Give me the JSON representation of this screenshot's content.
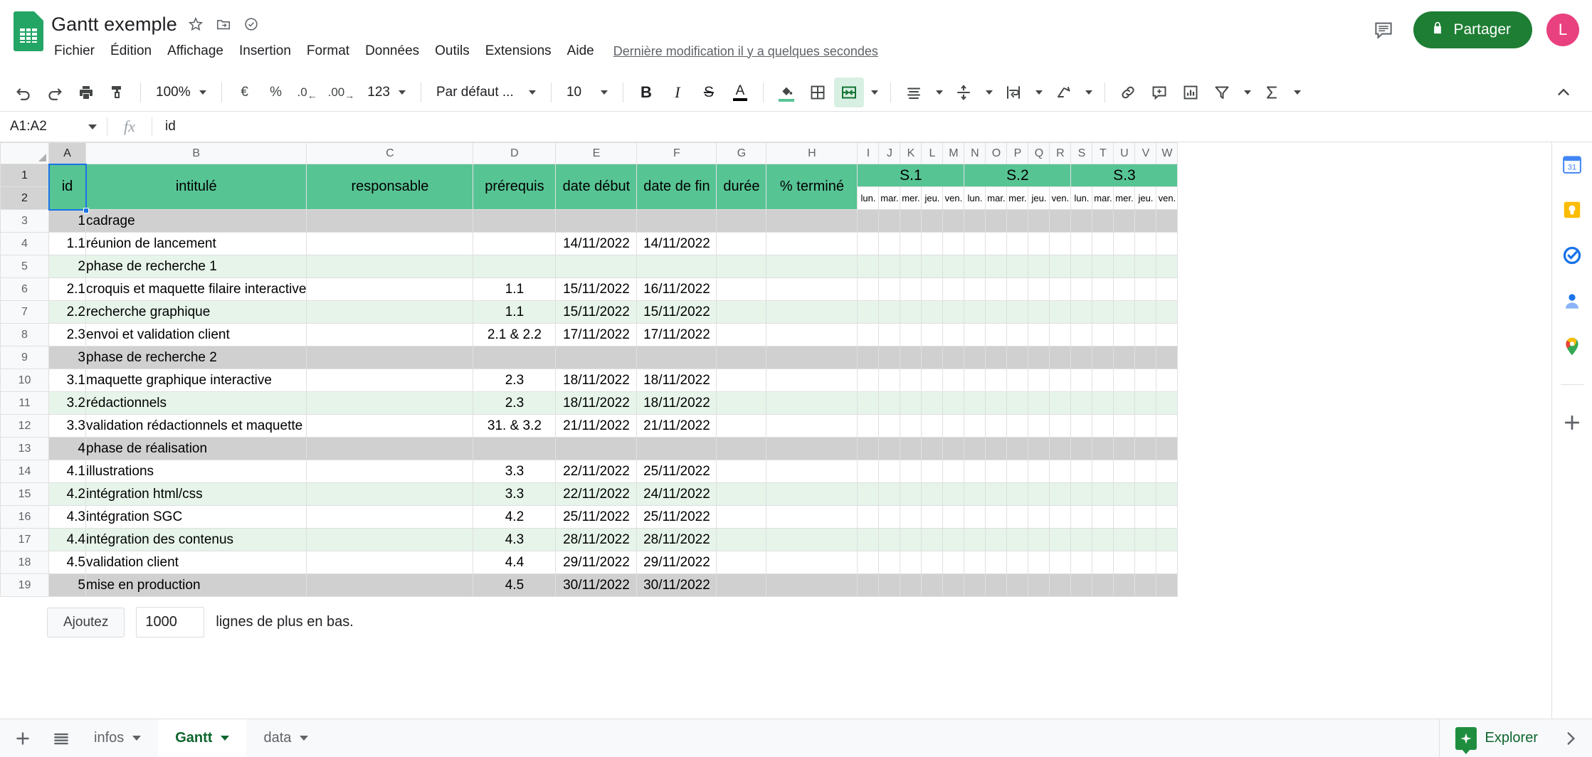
{
  "app": {
    "doc_title": "Gantt exemple",
    "logo_icon": "sheets-icon",
    "star_icon": "star-icon",
    "move_icon": "move-to-folder-icon",
    "cloud_icon": "cloud-saved-icon"
  },
  "menu": {
    "items": [
      {
        "label": "Fichier",
        "name": "menu-fichier"
      },
      {
        "label": "Édition",
        "name": "menu-edition"
      },
      {
        "label": "Affichage",
        "name": "menu-affichage"
      },
      {
        "label": "Insertion",
        "name": "menu-insertion"
      },
      {
        "label": "Format",
        "name": "menu-format"
      },
      {
        "label": "Données",
        "name": "menu-donnees"
      },
      {
        "label": "Outils",
        "name": "menu-outils"
      },
      {
        "label": "Extensions",
        "name": "menu-extensions"
      },
      {
        "label": "Aide",
        "name": "menu-aide"
      }
    ],
    "last_edit": "Dernière modification il y a quelques secondes"
  },
  "header_right": {
    "comment_icon": "comment-history-icon",
    "share_label": "Partager",
    "share_icon": "lock-icon",
    "share_color": "#1e7e34",
    "avatar_letter": "L",
    "avatar_color": "#e9417f"
  },
  "toolbar": {
    "undo": "undo-icon",
    "redo": "redo-icon",
    "print": "print-icon",
    "paint": "paint-format-icon",
    "zoom_value": "100%",
    "currency": "€",
    "percent": "%",
    "decimal_decrease": ".0",
    "decimal_increase": ".00",
    "number_format": "123",
    "font_name": "Par défaut ...",
    "font_size": "10",
    "bold": "B",
    "italic": "I",
    "strikethrough": "S",
    "text_color": "A",
    "fill_color": "fill-color-icon",
    "borders": "borders-icon",
    "merge_cells": "merge-cells-icon",
    "horizontal_align": "horizontal-align-icon",
    "vertical_align": "vertical-align-icon",
    "text_wrap": "text-wrap-icon",
    "text_rotation": "text-rotation-icon",
    "insert_link": "link-icon",
    "insert_comment": "insert-comment-icon",
    "insert_chart": "insert-chart-icon",
    "filter": "filter-icon",
    "functions": "sum-functions-icon",
    "collapse": "collapse-toolbar-icon"
  },
  "formula_bar": {
    "name_box": "A1:A2",
    "fx_label": "fx",
    "value": "id"
  },
  "grid": {
    "column_letters": [
      "A",
      "B",
      "C",
      "D",
      "E",
      "F",
      "G",
      "H",
      "I",
      "J",
      "K",
      "L",
      "M",
      "N",
      "O",
      "P",
      "Q",
      "R",
      "S",
      "T",
      "U",
      "V",
      "W"
    ],
    "selected_columns": [
      "A"
    ],
    "row_numbers": [
      1,
      2,
      3,
      4,
      5,
      6,
      7,
      8,
      9,
      10,
      11,
      12,
      13,
      14,
      15,
      16,
      17,
      18,
      19
    ],
    "selected_rows": [
      1,
      2
    ],
    "headers": {
      "id": "id",
      "intitule": "intitulé",
      "responsable": "responsable",
      "prerequis": "prérequis",
      "date_debut": "date début",
      "date_fin": "date de fin",
      "duree": "durée",
      "pct_termine": "% terminé"
    },
    "weeks": [
      {
        "label": "S.1",
        "days": [
          "lun.",
          "mar.",
          "mer.",
          "jeu.",
          "ven."
        ]
      },
      {
        "label": "S.2",
        "days": [
          "lun.",
          "mar.",
          "mer.",
          "jeu.",
          "ven."
        ]
      },
      {
        "label": "S.3",
        "days": [
          "lun.",
          "mar.",
          "mer.",
          "jeu.",
          "ven."
        ]
      }
    ],
    "header_color": "#57c494",
    "phase_row_color": "#d0d0d0",
    "alt_row_color": "#e6f4ea",
    "rows": [
      {
        "row": 3,
        "style": "r-gray",
        "id": "1",
        "intitule": "cadrage",
        "responsable": "",
        "prerequis": "",
        "date_debut": "",
        "date_fin": "",
        "duree": "",
        "pct": ""
      },
      {
        "row": 4,
        "style": "r-white",
        "id": "1.1",
        "intitule": "réunion de lancement",
        "responsable": "",
        "prerequis": "",
        "date_debut": "14/11/2022",
        "date_fin": "14/11/2022",
        "duree": "",
        "pct": ""
      },
      {
        "row": 5,
        "style": "r-green",
        "id": "2",
        "intitule": "phase de recherche 1",
        "responsable": "",
        "prerequis": "",
        "date_debut": "",
        "date_fin": "",
        "duree": "",
        "pct": ""
      },
      {
        "row": 6,
        "style": "r-white",
        "id": "2.1",
        "intitule": "croquis et maquette filaire interactive",
        "responsable": "",
        "prerequis": "1.1",
        "date_debut": "15/11/2022",
        "date_fin": "16/11/2022",
        "duree": "",
        "pct": ""
      },
      {
        "row": 7,
        "style": "r-green",
        "id": "2.2",
        "intitule": "recherche graphique",
        "responsable": "",
        "prerequis": "1.1",
        "date_debut": "15/11/2022",
        "date_fin": "15/11/2022",
        "duree": "",
        "pct": ""
      },
      {
        "row": 8,
        "style": "r-white",
        "id": "2.3",
        "intitule": "envoi et validation client",
        "responsable": "",
        "prerequis": "2.1 & 2.2",
        "date_debut": "17/11/2022",
        "date_fin": "17/11/2022",
        "duree": "",
        "pct": ""
      },
      {
        "row": 9,
        "style": "r-gray",
        "id": "3",
        "intitule": "phase de recherche 2",
        "responsable": "",
        "prerequis": "",
        "date_debut": "",
        "date_fin": "",
        "duree": "",
        "pct": ""
      },
      {
        "row": 10,
        "style": "r-white",
        "id": "3.1",
        "intitule": "maquette graphique interactive",
        "responsable": "",
        "prerequis": "2.3",
        "date_debut": "18/11/2022",
        "date_fin": "18/11/2022",
        "duree": "",
        "pct": ""
      },
      {
        "row": 11,
        "style": "r-green",
        "id": "3.2",
        "intitule": "rédactionnels",
        "responsable": "",
        "prerequis": "2.3",
        "date_debut": "18/11/2022",
        "date_fin": "18/11/2022",
        "duree": "",
        "pct": ""
      },
      {
        "row": 12,
        "style": "r-white",
        "id": "3.3",
        "intitule": "validation rédactionnels et maquette",
        "responsable": "",
        "prerequis": "31. & 3.2",
        "date_debut": "21/11/2022",
        "date_fin": "21/11/2022",
        "duree": "",
        "pct": ""
      },
      {
        "row": 13,
        "style": "r-gray",
        "id": "4",
        "intitule": "phase de réalisation",
        "responsable": "",
        "prerequis": "",
        "date_debut": "",
        "date_fin": "",
        "duree": "",
        "pct": ""
      },
      {
        "row": 14,
        "style": "r-white",
        "id": "4.1",
        "intitule": "illustrations",
        "responsable": "",
        "prerequis": "3.3",
        "date_debut": "22/11/2022",
        "date_fin": "25/11/2022",
        "duree": "",
        "pct": ""
      },
      {
        "row": 15,
        "style": "r-green",
        "id": "4.2",
        "intitule": "intégration html/css",
        "responsable": "",
        "prerequis": "3.3",
        "date_debut": "22/11/2022",
        "date_fin": "24/11/2022",
        "duree": "",
        "pct": ""
      },
      {
        "row": 16,
        "style": "r-white",
        "id": "4.3",
        "intitule": "intégration SGC",
        "responsable": "",
        "prerequis": "4.2",
        "date_debut": "25/11/2022",
        "date_fin": "25/11/2022",
        "duree": "",
        "pct": ""
      },
      {
        "row": 17,
        "style": "r-green",
        "id": "4.4",
        "intitule": "intégration des contenus",
        "responsable": "",
        "prerequis": "4.3",
        "date_debut": "28/11/2022",
        "date_fin": "28/11/2022",
        "duree": "",
        "pct": ""
      },
      {
        "row": 18,
        "style": "r-white",
        "id": "4.5",
        "intitule": "validation client",
        "responsable": "",
        "prerequis": "4.4",
        "date_debut": "29/11/2022",
        "date_fin": "29/11/2022",
        "duree": "",
        "pct": ""
      },
      {
        "row": 19,
        "style": "r-gray",
        "id": "5",
        "intitule": "mise en production",
        "responsable": "",
        "prerequis": "4.5",
        "date_debut": "30/11/2022",
        "date_fin": "30/11/2022",
        "duree": "",
        "pct": ""
      }
    ]
  },
  "add_rows": {
    "button_label": "Ajoutez",
    "count": "1000",
    "suffix": "lignes de plus en bas."
  },
  "sidepanel": {
    "items": [
      {
        "name": "google-calendar-icon"
      },
      {
        "name": "google-keep-icon"
      },
      {
        "name": "google-tasks-icon"
      },
      {
        "name": "google-contacts-icon"
      },
      {
        "name": "google-maps-icon"
      }
    ],
    "add_label": "+",
    "add_name": "get-add-ons-icon"
  },
  "bottom": {
    "add_sheet_icon": "add-sheet-icon",
    "all_sheets_icon": "all-sheets-icon",
    "tabs": [
      {
        "label": "infos",
        "active": false,
        "name": "sheet-tab-infos"
      },
      {
        "label": "Gantt",
        "active": true,
        "name": "sheet-tab-gantt"
      },
      {
        "label": "data",
        "active": false,
        "name": "sheet-tab-data"
      }
    ],
    "explorer_label": "Explorer",
    "explorer_icon": "explorer-icon",
    "chevron_icon": "chevron-right-icon"
  }
}
